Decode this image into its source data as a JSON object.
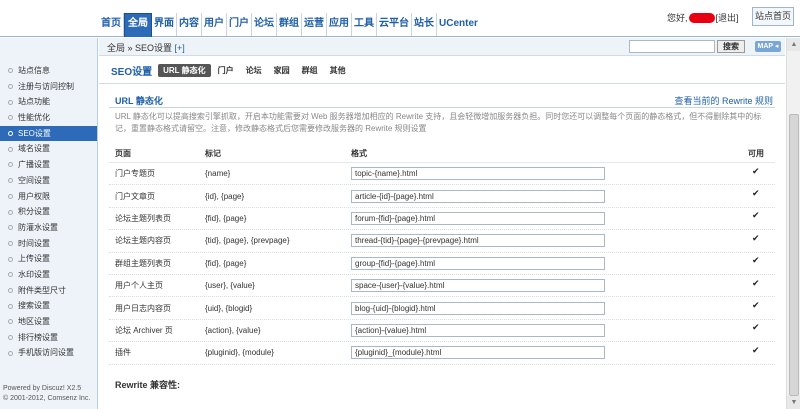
{
  "nav": {
    "items": [
      "首页",
      "全局",
      "界面",
      "内容",
      "用户",
      "门户",
      "论坛",
      "群组",
      "运营",
      "应用",
      "工具",
      "云平台",
      "站长",
      "UCenter"
    ],
    "active_index": 1
  },
  "user": {
    "greeting": "您好,",
    "logout": "[退出]",
    "home_button": "站点首页"
  },
  "sidebar": {
    "items": [
      "站点信息",
      "注册与访问控制",
      "站点功能",
      "性能优化",
      "SEO设置",
      "域名设置",
      "广播设置",
      "空间设置",
      "用户权限",
      "积分设置",
      "防灌水设置",
      "时间设置",
      "上传设置",
      "水印设置",
      "附件类型尺寸",
      "搜索设置",
      "地区设置",
      "排行榜设置",
      "手机版访问设置"
    ],
    "active_index": 4,
    "copyright_line1": "Powered by Discuz! X2.5",
    "copyright_line2": "© 2001-2012, Comsenz Inc."
  },
  "breadcrumb": {
    "text": "全局 » SEO设置",
    "add": "[+]"
  },
  "search": {
    "placeholder": "",
    "button": "搜索",
    "map_button": "MAP ◂"
  },
  "page": {
    "title": "SEO设置",
    "tabs": [
      "URL 静态化",
      "门户",
      "论坛",
      "家园",
      "群组",
      "其他"
    ],
    "active_tab": 0
  },
  "section": {
    "title": "URL 静态化",
    "link": "查看当前的 Rewrite 规则",
    "note": "URL 静态化可以提高搜索引擎抓取，开启本功能需要对 Web 服务器增加相应的 Rewrite 支持，且会轻微增加服务器负担。同时您还可以调整每个页面的静态格式，但不得删除其中的标记，重置静态格式请留空。注意，修改静态格式后您需要修改服务器的 Rewrite 规则设置"
  },
  "table": {
    "headers": [
      "页面",
      "标记",
      "格式",
      "可用"
    ],
    "rows": [
      {
        "page": "门户专题页",
        "marks": "{name}",
        "format": "topic-{name}.html",
        "enabled": true
      },
      {
        "page": "门户文章页",
        "marks": "{id}, {page}",
        "format": "article-{id}-{page}.html",
        "enabled": true
      },
      {
        "page": "论坛主题列表页",
        "marks": "{fid}, {page}",
        "format": "forum-{fid}-{page}.html",
        "enabled": true
      },
      {
        "page": "论坛主题内容页",
        "marks": "{tid}, {page}, {prevpage}",
        "format": "thread-{tid}-{page}-{prevpage}.html",
        "enabled": true
      },
      {
        "page": "群组主题列表页",
        "marks": "{fid}, {page}",
        "format": "group-{fid}-{page}.html",
        "enabled": true
      },
      {
        "page": "用户个人主页",
        "marks": "{user}, {value}",
        "format": "space-{user}-{value}.html",
        "enabled": true
      },
      {
        "page": "用户日志内容页",
        "marks": "{uid}, {blogid}",
        "format": "blog-{uid}-{blogid}.html",
        "enabled": true
      },
      {
        "page": "论坛 Archiver 页",
        "marks": "{action}, {value}",
        "format": "{action}-{value}.html",
        "enabled": true
      },
      {
        "page": "插件",
        "marks": "{pluginid}, {module}",
        "format": "{pluginid}_{module}.html",
        "enabled": true
      }
    ]
  },
  "compat_label": "Rewrite 兼容性:",
  "colors": {
    "accent": "#2d6bb8",
    "link": "#1f5fa8",
    "sidebar_bg": "#edf3f8",
    "redaction": "#e60012"
  }
}
